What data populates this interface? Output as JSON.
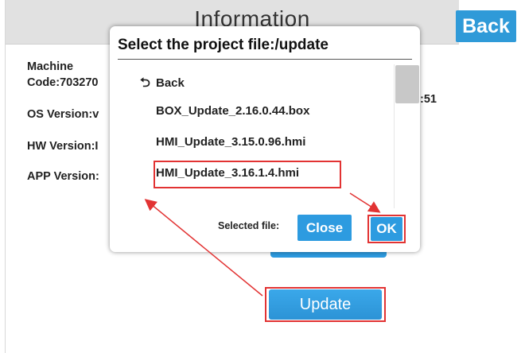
{
  "header": {
    "title": "Information",
    "back_label": "Back"
  },
  "info": {
    "machine_code_line1": "Machine",
    "machine_code_line2": "Code:703270",
    "os_version": "OS Version:v",
    "hw_version": "HW Version:I",
    "app_version": "APP Version:",
    "time_fragment": ":51"
  },
  "update_button": {
    "label": "Update"
  },
  "dialog": {
    "title": "Select the project file:/update",
    "back_label": "Back",
    "files": [
      "BOX_Update_2.16.0.44.box",
      "HMI_Update_3.15.0.96.hmi",
      "HMI_Update_3.16.1.4.hmi"
    ],
    "selected_index": 2,
    "selected_file_label": "Selected file:",
    "close_label": "Close",
    "ok_label": "OK"
  },
  "colors": {
    "button_blue": "#2d9be0",
    "annotation_red": "#e23333",
    "header_gray": "#e1e1e1"
  }
}
